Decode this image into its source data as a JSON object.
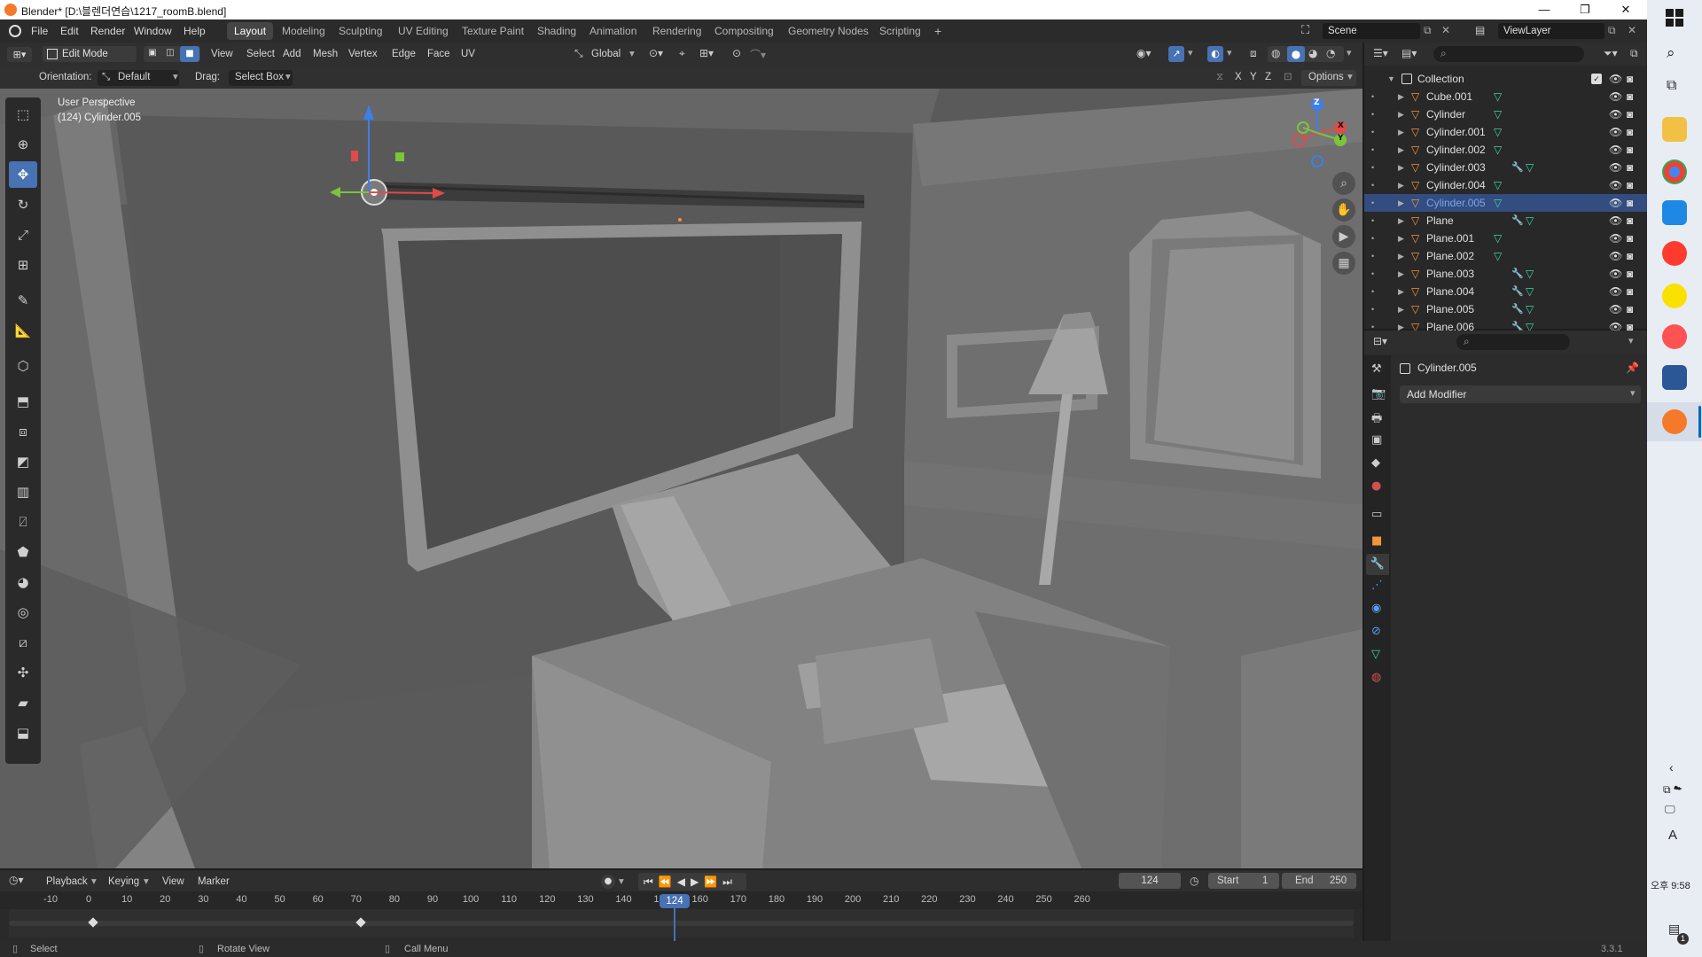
{
  "window": {
    "title": "Blender* [D:\\블렌더연습\\1217_roomB.blend]"
  },
  "menus": [
    "File",
    "Edit",
    "Render",
    "Window",
    "Help"
  ],
  "workspaces": [
    {
      "label": "Layout",
      "active": true
    },
    {
      "label": "Modeling"
    },
    {
      "label": "Sculpting"
    },
    {
      "label": "UV Editing"
    },
    {
      "label": "Texture Paint"
    },
    {
      "label": "Shading"
    },
    {
      "label": "Animation"
    },
    {
      "label": "Rendering"
    },
    {
      "label": "Compositing"
    },
    {
      "label": "Geometry Nodes"
    },
    {
      "label": "Scripting"
    }
  ],
  "scene": {
    "name": "Scene",
    "view_layer": "ViewLayer"
  },
  "viewport_header": {
    "mode": "Edit Mode",
    "menus": [
      "View",
      "Select",
      "Add",
      "Mesh",
      "Vertex",
      "Edge",
      "Face",
      "UV"
    ],
    "transform_orientation": "Global"
  },
  "viewport_sub": {
    "orientation_label": "Orientation:",
    "orientation_value": "Default",
    "drag_label": "Drag:",
    "drag_value": "Select Box",
    "axes": [
      "X",
      "Y",
      "Z"
    ],
    "options": "Options"
  },
  "viewport": {
    "perspective": "User Perspective",
    "object_info": "(124) Cylinder.005",
    "gizmo_axes": [
      "Z",
      "Y",
      "X"
    ]
  },
  "timeline": {
    "menus": [
      "Playback",
      "Keying",
      "View",
      "Marker"
    ],
    "current_frame": "124",
    "start_label": "Start",
    "start": "1",
    "end_label": "End",
    "end": "250",
    "ruler": [
      "-10",
      "0",
      "10",
      "20",
      "30",
      "40",
      "50",
      "60",
      "70",
      "80",
      "90",
      "100",
      "110",
      "120",
      "130",
      "140",
      "150",
      "160",
      "170",
      "180",
      "190",
      "200",
      "210",
      "220",
      "230",
      "240",
      "250",
      "260"
    ]
  },
  "outliner": {
    "collection": "Collection",
    "items": [
      {
        "name": "Cube.001",
        "modifier": false
      },
      {
        "name": "Cylinder",
        "modifier": false
      },
      {
        "name": "Cylinder.001",
        "modifier": false
      },
      {
        "name": "Cylinder.002",
        "modifier": false
      },
      {
        "name": "Cylinder.003",
        "modifier": true
      },
      {
        "name": "Cylinder.004",
        "modifier": false
      },
      {
        "name": "Cylinder.005",
        "modifier": false,
        "selected": true
      },
      {
        "name": "Plane",
        "modifier": true
      },
      {
        "name": "Plane.001",
        "modifier": false
      },
      {
        "name": "Plane.002",
        "modifier": false
      },
      {
        "name": "Plane.003",
        "modifier": true
      },
      {
        "name": "Plane.004",
        "modifier": true
      },
      {
        "name": "Plane.005",
        "modifier": true
      },
      {
        "name": "Plane.006",
        "modifier": true
      }
    ]
  },
  "properties": {
    "object_name": "Cylinder.005",
    "add_modifier": "Add Modifier"
  },
  "statusbar": {
    "select": "Select",
    "rotate": "Rotate View",
    "menu": "Call Menu",
    "version": "3.3.1"
  },
  "taskbar": {
    "time": "오후 9:58",
    "ime": "A",
    "notif": "1"
  },
  "colors": {
    "accent": "#4772b3",
    "selected_text": "#78a6e8",
    "mesh_icon": "#f5943a",
    "data_icon": "#3fd4a4"
  }
}
